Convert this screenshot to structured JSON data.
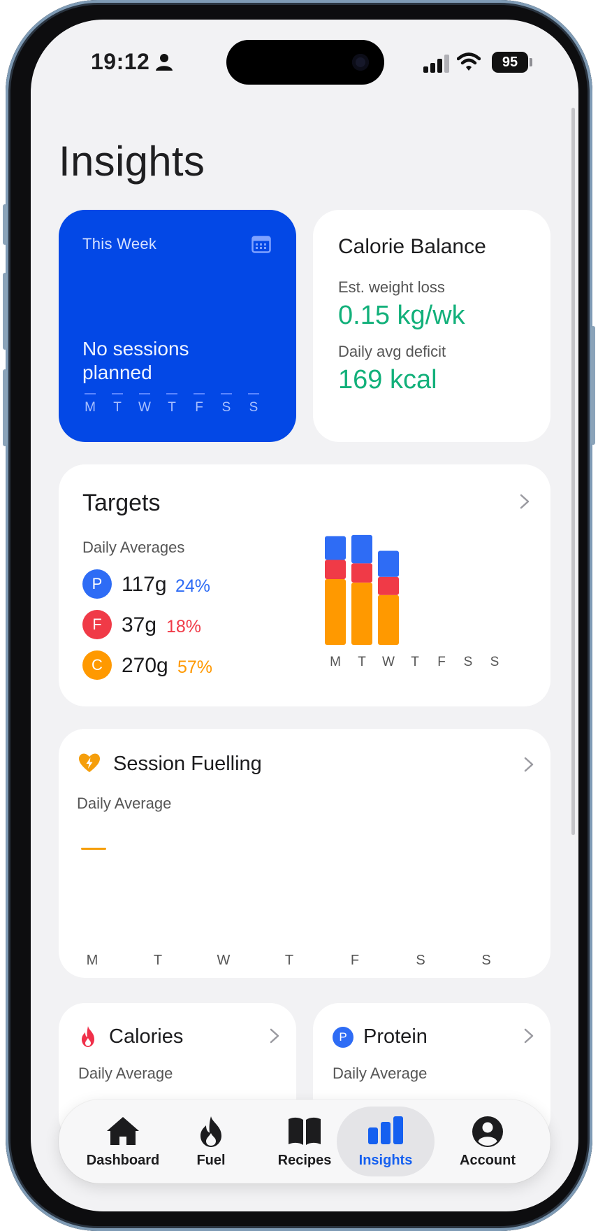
{
  "status_bar": {
    "time": "19:12",
    "battery": "95"
  },
  "page_title": "Insights",
  "this_week": {
    "title": "This Week",
    "message": "No sessions planned",
    "days": [
      "M",
      "T",
      "W",
      "T",
      "F",
      "S",
      "S"
    ]
  },
  "calorie_balance": {
    "title": "Calorie Balance",
    "weight_label": "Est. weight loss",
    "weight_value": "0.15 kg/wk",
    "deficit_label": "Daily avg deficit",
    "deficit_value": "169 kcal",
    "value_color": "#12b07a"
  },
  "targets": {
    "title": "Targets",
    "subtitle": "Daily Averages",
    "macros": [
      {
        "letter": "P",
        "value": "117g",
        "percent": "24%",
        "color": "#2e6cf5"
      },
      {
        "letter": "F",
        "value": "37g",
        "percent": "18%",
        "color": "#f03a47"
      },
      {
        "letter": "C",
        "value": "270g",
        "percent": "57%",
        "color": "#ff9900"
      }
    ]
  },
  "chart_data": {
    "type": "bar",
    "stacked": true,
    "categories": [
      "M",
      "T",
      "W",
      "T",
      "F",
      "S",
      "S"
    ],
    "series": [
      {
        "name": "Carbs",
        "color": "#ff9900",
        "values": [
          0.58,
          0.55,
          0.44,
          0,
          0,
          0,
          0
        ]
      },
      {
        "name": "Fat",
        "color": "#f03a47",
        "values": [
          0.17,
          0.17,
          0.16,
          0,
          0,
          0,
          0
        ]
      },
      {
        "name": "Protein",
        "color": "#2e6cf5",
        "values": [
          0.21,
          0.25,
          0.23,
          0,
          0,
          0,
          0
        ]
      }
    ]
  },
  "session_fuelling": {
    "title": "Session Fuelling",
    "subtitle": "Daily Average",
    "days": [
      "M",
      "T",
      "W",
      "T",
      "F",
      "S",
      "S"
    ]
  },
  "calories_card": {
    "title": "Calories",
    "subtitle": "Daily Average"
  },
  "protein_card": {
    "title": "Protein",
    "subtitle": "Daily Average",
    "badge": "P"
  },
  "tabbar": {
    "active": "Insights",
    "tabs": [
      {
        "label": "Dashboard",
        "icon": "home-icon"
      },
      {
        "label": "Fuel",
        "icon": "flame-icon"
      },
      {
        "label": "Recipes",
        "icon": "book-icon"
      },
      {
        "label": "Insights",
        "icon": "bar-chart-icon"
      },
      {
        "label": "Account",
        "icon": "person-circle-icon"
      }
    ]
  },
  "colors": {
    "accent_blue": "#0348e6",
    "tab_active": "#1560f0",
    "fuelling": "#f59e0b"
  }
}
